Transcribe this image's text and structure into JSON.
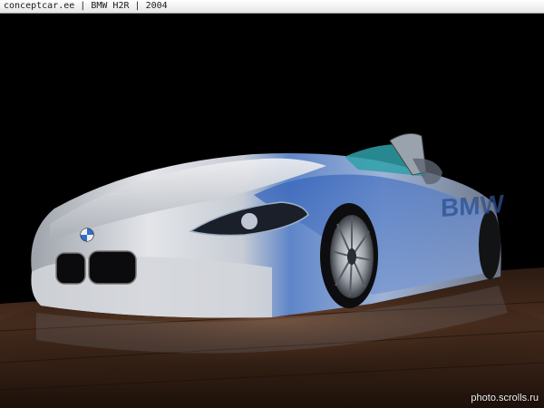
{
  "caption": {
    "site": "conceptcar.ee",
    "model": "BMW H2R",
    "year": "2004",
    "separator": " | "
  },
  "photo": {
    "subject": "BMW H2R hydrogen concept car",
    "side_lettering": "BMW",
    "colors": {
      "background": "#000000",
      "body_silver": "#c9ccd2",
      "body_blue": "#3f6fc8",
      "floor": "#3a2418",
      "interior": "#2fa0a8"
    }
  },
  "watermark": "photo.scrolls.ru"
}
